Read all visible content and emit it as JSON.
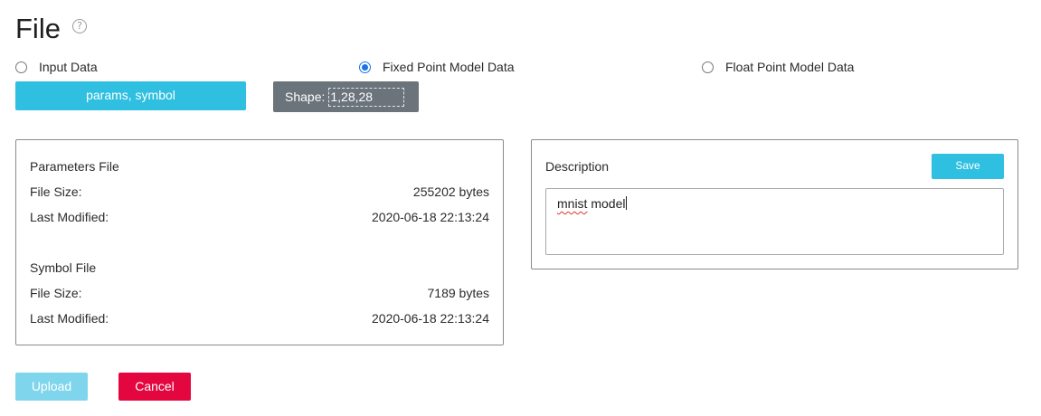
{
  "header": {
    "title": "File",
    "help_icon": "question-circle-icon",
    "help_glyph": "?"
  },
  "data_type": {
    "options": [
      {
        "label": "Input Data",
        "checked": false
      },
      {
        "label": "Fixed Point Model Data",
        "checked": true
      },
      {
        "label": "Float Point Model Data",
        "checked": false
      }
    ]
  },
  "files_button": {
    "label": "params, symbol"
  },
  "shape": {
    "label": "Shape:",
    "value": "1,28,28"
  },
  "parameters_file": {
    "heading": "Parameters File",
    "size_label": "File Size:",
    "size_value": "255202 bytes",
    "modified_label": "Last Modified:",
    "modified_value": "2020-06-18 22:13:24"
  },
  "symbol_file": {
    "heading": "Symbol File",
    "size_label": "File Size:",
    "size_value": "7189 bytes",
    "modified_label": "Last Modified:",
    "modified_value": "2020-06-18 22:13:24"
  },
  "description": {
    "label": "Description",
    "save_label": "Save",
    "text_first": "mnist",
    "text_rest": " model"
  },
  "footer": {
    "upload_label": "Upload",
    "cancel_label": "Cancel"
  },
  "colors": {
    "accent": "#2fbfe0",
    "upload_disabled": "#7fd6ec",
    "danger": "#e3063f",
    "shape_bg": "#6b737b",
    "radio_selected": "#1a73e8"
  }
}
